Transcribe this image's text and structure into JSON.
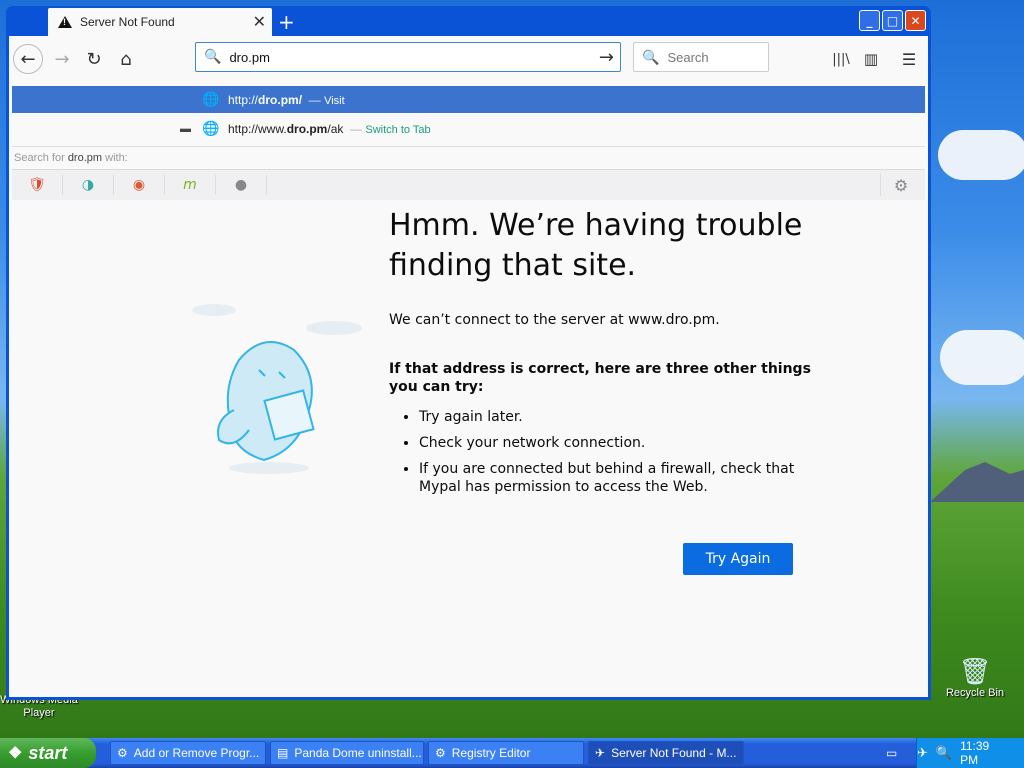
{
  "desktop": {
    "icons": {
      "recycle_bin": "Recycle Bin",
      "media_player_line1": "Windows Media",
      "media_player_line2": "Player"
    }
  },
  "browser": {
    "tab": {
      "title": "Server Not Found",
      "close": "✕"
    },
    "new_tab": "+",
    "window_buttons": {
      "minimize": "_",
      "maximize": "□",
      "close": "✕"
    },
    "nav": {
      "back": "←",
      "forward": "→",
      "reload": "↻",
      "home": "⌂"
    },
    "urlbar": {
      "value": "dro.pm",
      "go": "→"
    },
    "search": {
      "placeholder": "Search"
    },
    "toolbar_icons": {
      "library": "|||\\",
      "sidebar": "▥",
      "menu": "☰"
    },
    "suggestions": [
      {
        "url_pre": "http://",
        "url_bold": "dro.pm",
        "url_post": "/",
        "action": "Visit"
      },
      {
        "url_pre": "http://www.",
        "url_bold": "dro.pm",
        "url_post": "/ak",
        "action": "Switch to Tab"
      }
    ],
    "search_with": {
      "prefix": "Search for",
      "term": "dro.pm",
      "suffix": "with:"
    }
  },
  "error_page": {
    "title_line1": "Hmm. We’re having trouble",
    "title_line2": "finding that site.",
    "description": "We can’t connect to the server at www.dro.pm.",
    "subhead": "If that address is correct, here are three other things you can try:",
    "tips": [
      "Try again later.",
      "Check your network connection.",
      "If you are connected but behind a firewall, check that Mypal has permission to access the Web."
    ],
    "button": "Try Again"
  },
  "taskbar": {
    "start": "start",
    "items": [
      {
        "label": "Add or Remove Progr...",
        "icon": "⚙"
      },
      {
        "label": "Panda Dome uninstall...",
        "icon": "▤"
      },
      {
        "label": "Registry Editor",
        "icon": "⚙"
      },
      {
        "label": "Server Not Found - M...",
        "icon": "✈"
      }
    ],
    "clock": "11:39 PM"
  },
  "colors": {
    "accent": "#0a6ce0",
    "selection": "#3b73cf",
    "xp_blue": "#245edb"
  }
}
